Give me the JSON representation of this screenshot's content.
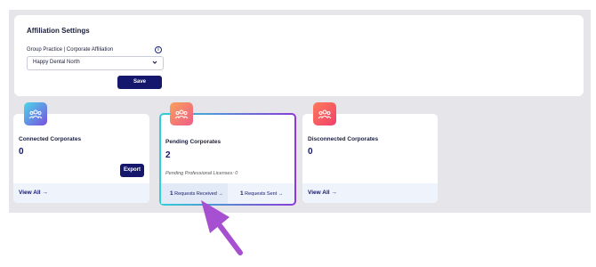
{
  "settings": {
    "title": "Affiliation Settings",
    "field_label": "Group Practice | Corporate Affiliation",
    "info_icon": "i",
    "selected_value": "Happy Dental North",
    "save_label": "Save"
  },
  "cards": {
    "connected": {
      "title": "Connected Corporates",
      "count": "0",
      "export_label": "Export",
      "view_all": "View All →"
    },
    "pending": {
      "title": "Pending Corporates",
      "count": "2",
      "note": "Pending Professional Licenses: 0",
      "received_count": "1",
      "received_label": "Requests Received →",
      "sent_count": "1",
      "sent_label": "Requests Sent →"
    },
    "disconnected": {
      "title": "Disconnected Corporates",
      "count": "0",
      "view_all": "View All →"
    }
  },
  "icons": {
    "card_badge": "group-icon",
    "dropdown": "chevron-down-icon",
    "annotation": "pointer-arrow"
  },
  "colors": {
    "primary": "#14176b",
    "annotation_arrow": "#a64fd0",
    "pending_border_start": "#2fd0d6",
    "pending_border_end": "#8a3ad6"
  }
}
